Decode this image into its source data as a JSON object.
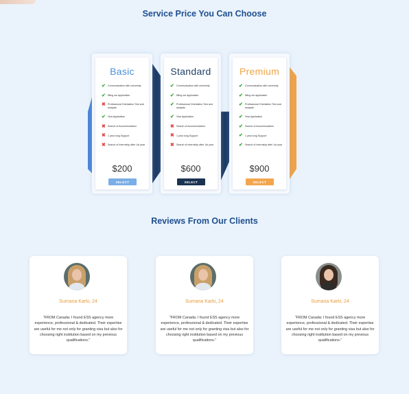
{
  "pricing_section": {
    "title": "Service Price You Can Choose",
    "plans": [
      {
        "name": "Basic",
        "name_color": "#4a8fd6",
        "accent": "#4a86d8",
        "features": [
          {
            "text": "Communication with university",
            "included": true
          },
          {
            "text": "filling out application",
            "included": true
          },
          {
            "text": "Professional Orientation Test and analysis",
            "included": false
          },
          {
            "text": "Visa Application",
            "included": true
          },
          {
            "text": "Search of Accommodation",
            "included": false
          },
          {
            "text": "1 year long Support",
            "included": false
          },
          {
            "text": "Search of Internship after 1st year",
            "included": false
          }
        ],
        "price": "$200",
        "button_label": "SELECT",
        "button_color": "#7aaee6"
      },
      {
        "name": "Standard",
        "name_color": "#1f3f66",
        "accent": "#1d3d66",
        "features": [
          {
            "text": "Communication with university",
            "included": true
          },
          {
            "text": "filling out application",
            "included": true
          },
          {
            "text": "Professional Orientation Test and analysis",
            "included": true
          },
          {
            "text": "Visa Application",
            "included": true
          },
          {
            "text": "Search of Accommodation",
            "included": false
          },
          {
            "text": "1 year long Support",
            "included": false
          },
          {
            "text": "Search of Internship after 1st year",
            "included": false
          }
        ],
        "price": "$600",
        "button_label": "SELECT",
        "button_color": "#1b3352"
      },
      {
        "name": "Premium",
        "name_color": "#f0a443",
        "accent": "#f0a24a",
        "features": [
          {
            "text": "Communication with university",
            "included": true
          },
          {
            "text": "filling out application",
            "included": true
          },
          {
            "text": "Professional Orientation Test and analysis",
            "included": true
          },
          {
            "text": "Visa Application",
            "included": true
          },
          {
            "text": "Search of Accommodation",
            "included": true
          },
          {
            "text": "1 year long Support",
            "included": true
          },
          {
            "text": "Search of Internship after 1st year",
            "included": true
          }
        ],
        "price": "$900",
        "button_label": "SELECT",
        "button_color": "#f3a64f"
      }
    ]
  },
  "reviews_section": {
    "title": "Reviews From Our Clients",
    "reviews": [
      {
        "name": "Sumana Karki, 24",
        "quote": "\"FROM Canada: I found ESS agency more experience, professional & dedicated. Their expertise are useful for me not only for granting visa but also for choosing right institution based on my previous qualifications.\"",
        "hair_color": "#c9a06a",
        "top_color": "#e3e8ee"
      },
      {
        "name": "Sumana Karki, 24",
        "quote": "\"FROM Canada: I found ESS agency more experience, professional & dedicated. Their expertise are useful for me not only for granting visa but also for choosing right institution based on my previous qualifications.\"",
        "hair_color": "#c9a06a",
        "top_color": "#e3e8ee"
      },
      {
        "name": "Sumana Karki, 24",
        "quote": "\"FROM Canada: I found ESS agency more experience, professional & dedicated. Their expertise are useful for me not only for granting visa but also for choosing right institution based on my previous qualifications.\"",
        "hair_color": "#3a2a22",
        "top_color": "#2d2d2d"
      }
    ]
  }
}
